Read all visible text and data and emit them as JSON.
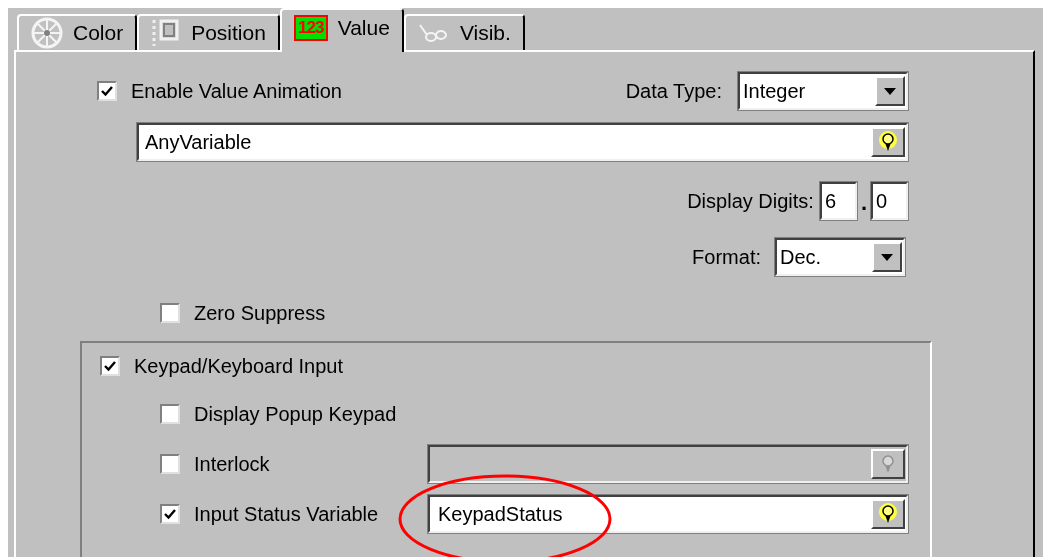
{
  "tabs": [
    {
      "label": "Color",
      "selected": false,
      "kind": "wheel"
    },
    {
      "label": "Position",
      "selected": false,
      "kind": "position"
    },
    {
      "label": "Value",
      "selected": true,
      "kind": "digits",
      "icon_text": "123"
    },
    {
      "label": "Visib.",
      "selected": false,
      "kind": "glasses"
    }
  ],
  "enable_animation": {
    "label": "Enable Value Animation",
    "checked": true
  },
  "data_type": {
    "label": "Data Type:",
    "value": "Integer"
  },
  "variable": {
    "value": "AnyVariable"
  },
  "display_digits": {
    "label": "Display Digits:",
    "whole": "6",
    "separator": ".",
    "fraction": "0"
  },
  "format": {
    "label": "Format:",
    "value": "Dec."
  },
  "zero_suppress": {
    "label": "Zero Suppress",
    "checked": false
  },
  "keypad_group": {
    "label": "Keypad/Keyboard Input",
    "checked": true,
    "options": [
      {
        "kind": "checkbox",
        "label": "Display Popup Keypad",
        "checked": false
      },
      {
        "kind": "field",
        "label": "Interlock",
        "checked": false,
        "disabled": true
      },
      {
        "kind": "field",
        "label": "Input Status Variable",
        "checked": true,
        "disabled": false,
        "value": "KeypadStatus",
        "highlighted": true
      }
    ]
  }
}
